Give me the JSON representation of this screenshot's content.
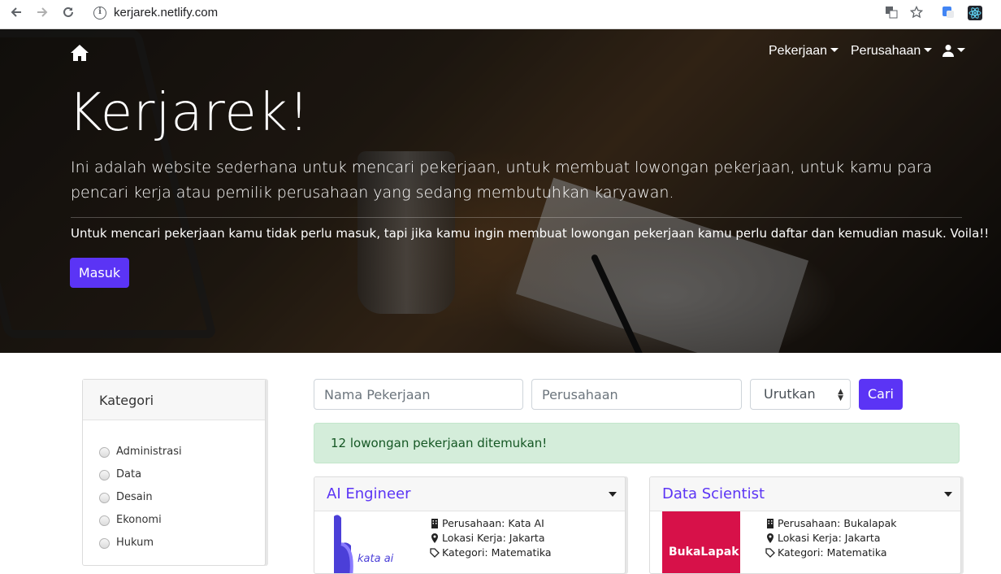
{
  "browser": {
    "url": "kerjarek.netlify.com",
    "back_icon": "arrow-left-icon",
    "forward_icon": "arrow-right-icon",
    "reload_icon": "reload-icon"
  },
  "nav": {
    "home_icon": "home-icon",
    "pekerjaan": "Pekerjaan",
    "perusahaan": "Perusahaan",
    "user_icon": "user-icon"
  },
  "hero": {
    "title": "Kerjarek!",
    "lead": "Ini adalah website sederhana untuk mencari pekerjaan, untuk membuat lowongan pekerjaan, untuk kamu para pencari kerja atau pemilik perusahaan yang sedang membutuhkan karyawan.",
    "sub": "Untuk mencari pekerjaan kamu tidak perlu masuk, tapi jika kamu ingin membuat lowongan pekerjaan kamu perlu daftar dan kemudian masuk. Voila!!",
    "login_label": "Masuk"
  },
  "sidebar": {
    "title": "Kategori",
    "items": [
      {
        "label": "Administrasi"
      },
      {
        "label": "Data"
      },
      {
        "label": "Desain"
      },
      {
        "label": "Ekonomi"
      },
      {
        "label": "Hukum"
      }
    ]
  },
  "search": {
    "job_placeholder": "Nama Pekerjaan",
    "company_placeholder": "Perusahaan",
    "sort_label": "Urutkan",
    "submit_label": "Cari"
  },
  "result": {
    "message": "12 lowongan pekerjaan ditemukan!"
  },
  "jobs": [
    {
      "title": "AI Engineer",
      "company": "Perusahaan: Kata AI",
      "location": "Lokasi Kerja: Jakarta",
      "category": "Kategori: Matematika",
      "logo_text": "kata ai"
    },
    {
      "title": "Data Scientist",
      "company": "Perusahaan: Bukalapak",
      "location": "Lokasi Kerja: Jakarta",
      "category": "Kategori: Matematika",
      "logo_text": "BukaLapak"
    }
  ],
  "colors": {
    "primary": "#5b34f5",
    "success_bg": "#d4edda",
    "success_text": "#155724",
    "bukalapak": "#d71149"
  }
}
